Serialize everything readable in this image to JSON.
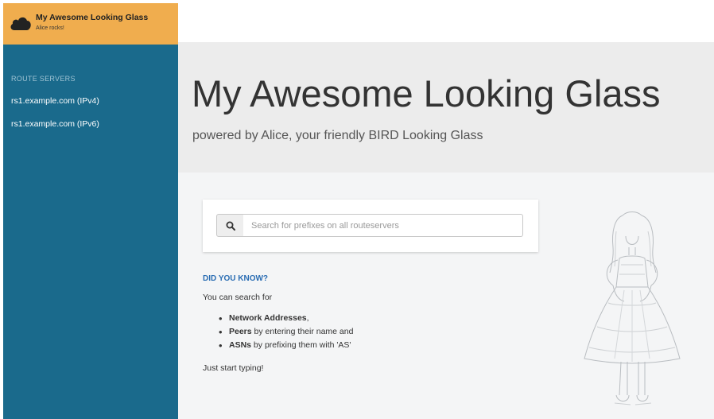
{
  "brand": {
    "title": "My Awesome Looking Glass",
    "subtitle": "Alice rocks!",
    "icon": "cloud-icon"
  },
  "sidebar": {
    "heading": "ROUTE SERVERS",
    "items": [
      {
        "label": "rs1.example.com (IPv4)"
      },
      {
        "label": "rs1.example.com (IPv6)"
      }
    ]
  },
  "hero": {
    "title": "My Awesome Looking Glass",
    "tagline": "powered by Alice, your friendly BIRD Looking Glass"
  },
  "search": {
    "placeholder": "Search for prefixes on all routeservers",
    "value": "",
    "icon": "search-icon"
  },
  "tips": {
    "heading": "DID YOU KNOW?",
    "intro": "You can search for",
    "items": [
      {
        "bold": "Network Addresses",
        "rest": ","
      },
      {
        "bold": "Peers",
        "rest": " by entering their name and"
      },
      {
        "bold": "ASNs",
        "rest": " by prefixing them with 'AS'"
      }
    ],
    "outro": "Just start typing!"
  },
  "colors": {
    "brand_bg": "#f0ad4e",
    "sidebar_bg": "#1a6a8c",
    "hero_bg": "#ececec",
    "link_accent": "#2a6db3"
  }
}
